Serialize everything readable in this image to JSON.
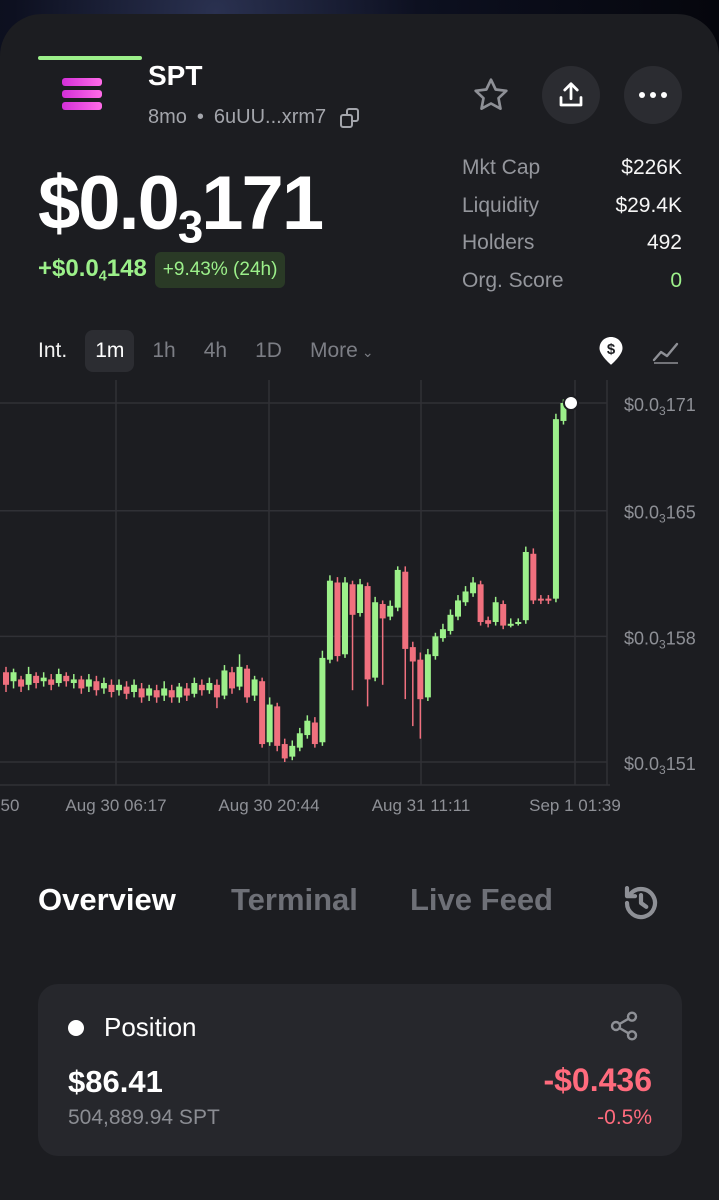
{
  "token": {
    "name": "SPT",
    "age": "8mo",
    "separator": "•",
    "address": "6uUU...xrm7",
    "price_prefix": "$0.0",
    "price_sub": "3",
    "price_main": "171",
    "change_prefix": "+$0.0",
    "change_sub": "4",
    "change_main": "148",
    "change_pct": "+9.43% (24h)"
  },
  "stats": [
    {
      "label": "Mkt Cap",
      "value": "$226K"
    },
    {
      "label": "Liquidity",
      "value": "$29.4K"
    },
    {
      "label": "Holders",
      "value": "492"
    },
    {
      "label": "Org. Score",
      "value": "0"
    }
  ],
  "timeframes": {
    "interval_label": "Int.",
    "items": [
      "1m",
      "1h",
      "4h",
      "1D"
    ],
    "more_label": "More",
    "selected": "1m"
  },
  "chart_data": {
    "type": "candlestick",
    "y_ticks": [
      {
        "prefix": "$0.0",
        "sub": "3",
        "main": "171",
        "value": 0.000171
      },
      {
        "prefix": "$0.0",
        "sub": "3",
        "main": "165",
        "value": 0.000165
      },
      {
        "prefix": "$0.0",
        "sub": "3",
        "main": "158",
        "value": 0.000158
      },
      {
        "prefix": "$0.0",
        "sub": "3",
        "main": "151",
        "value": 0.000151
      }
    ],
    "x_ticks": [
      "50",
      "Aug 30 06:17",
      "Aug 30 20:44",
      "Aug 31 11:11",
      "Sep 1 01:39"
    ],
    "ylim": [
      0.000151,
      0.000171
    ],
    "last_price": 0.000171
  },
  "tabs": [
    "Overview",
    "Terminal",
    "Live Feed"
  ],
  "position": {
    "title": "Position",
    "value": "$86.41",
    "quantity": "504,889.94 SPT",
    "pnl": "-$0.436",
    "pnl_pct": "-0.5%"
  },
  "colors": {
    "up": "#9cf08a",
    "down": "#f0707e",
    "background": "#1c1d21"
  }
}
